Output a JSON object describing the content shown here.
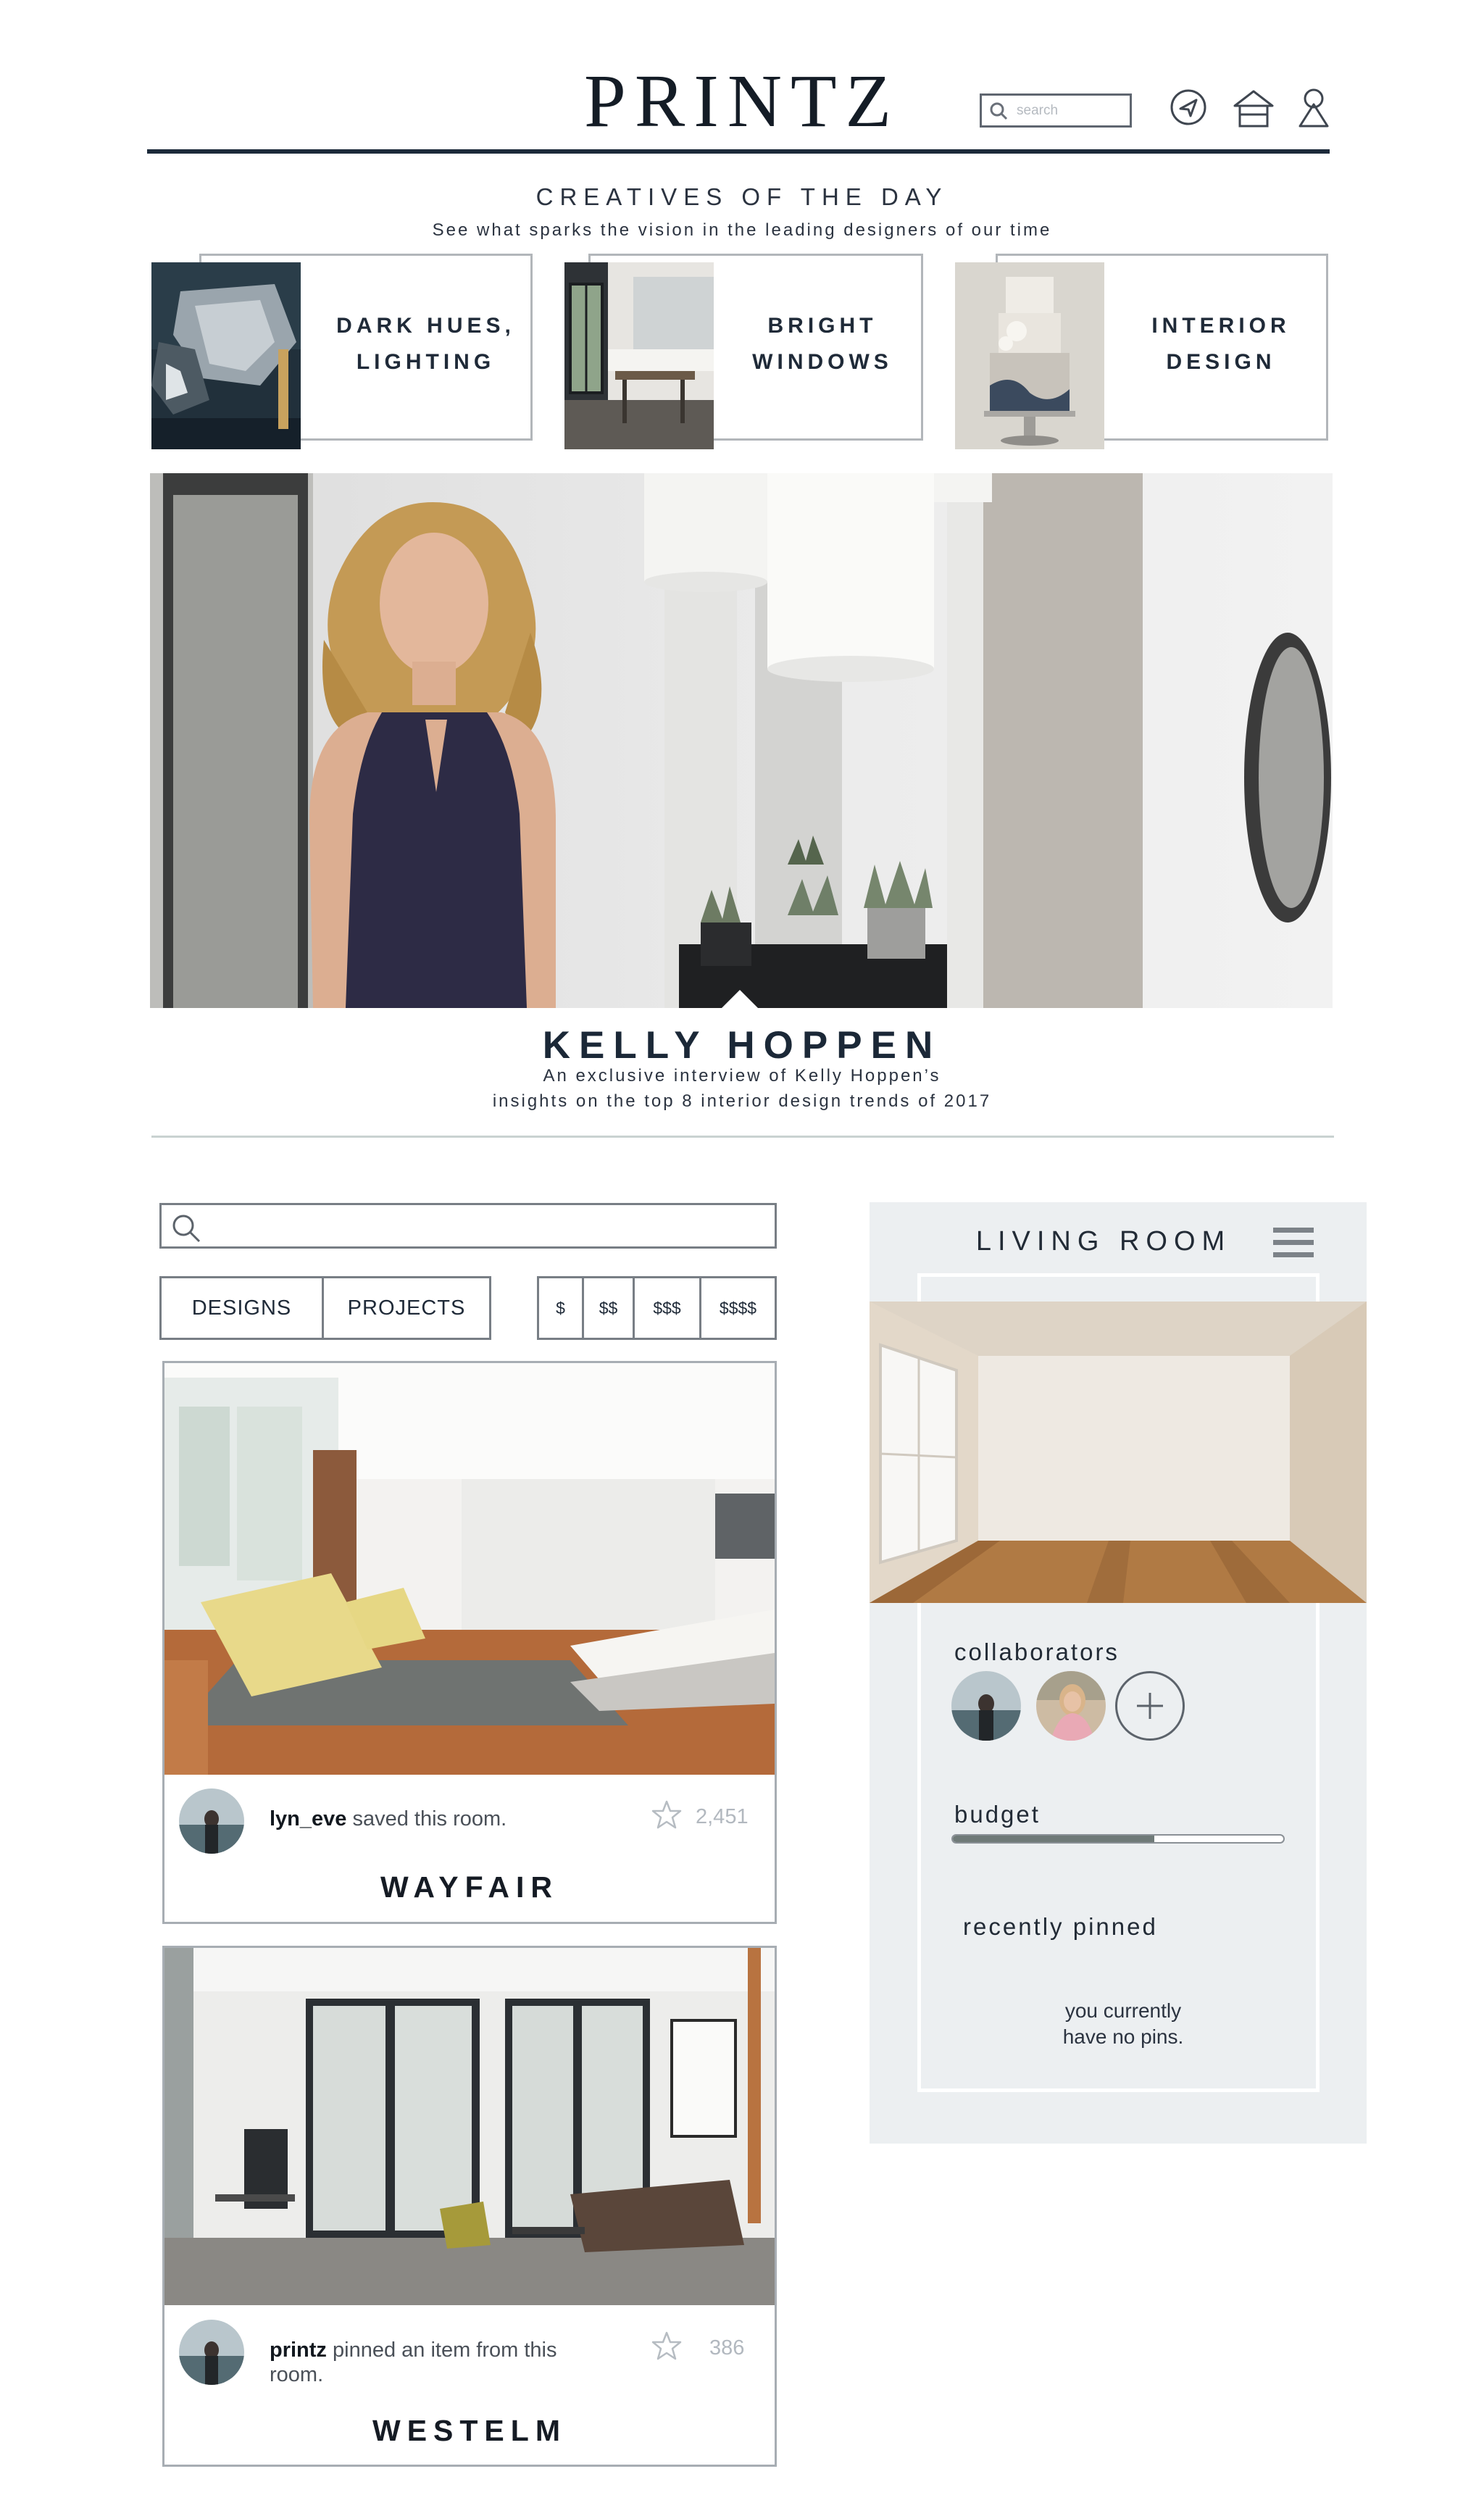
{
  "header": {
    "logo": "PRINTZ",
    "search_placeholder": "search",
    "icons": [
      "search-icon",
      "send-icon",
      "home-icon",
      "profile-icon"
    ]
  },
  "creatives": {
    "title": "CREATIVES OF THE DAY",
    "subtitle": "See what sparks the vision in the leading designers of our time",
    "cards": [
      {
        "line1": "DARK HUES,",
        "line2": "LIGHTING"
      },
      {
        "line1": "BRIGHT",
        "line2": "WINDOWS"
      },
      {
        "line1": "INTERIOR",
        "line2": "DESIGN"
      }
    ]
  },
  "hero": {
    "name": "KELLY HOPPEN",
    "line1": "An exclusive interview of Kelly Hoppen’s",
    "line2": "insights on the top 8 interior design trends of 2017"
  },
  "filters": {
    "search_placeholder": "",
    "types": [
      "DESIGNS",
      "PROJECTS"
    ],
    "prices": [
      "$",
      "$$",
      "$$$",
      "$$$$"
    ]
  },
  "posts": [
    {
      "user": "lyn_eve",
      "action": " saved this room.",
      "count": "2,451",
      "brand": "WAYFAIR"
    },
    {
      "user": "printz",
      "action": " pinned an item from this room.",
      "count": "386",
      "brand": "WESTELM"
    }
  ],
  "board": {
    "title": "LIVING ROOM",
    "collaborators_label": "collaborators",
    "budget_label": "budget",
    "budget_fraction": 0.61,
    "recent_label": "recently pinned",
    "no_pins_line1": "you currently",
    "no_pins_line2": "have no pins."
  },
  "colors": {
    "accent": "#1c2a3a",
    "panel_bg": "#eceff1",
    "budget_fill": "#6f7a78"
  }
}
